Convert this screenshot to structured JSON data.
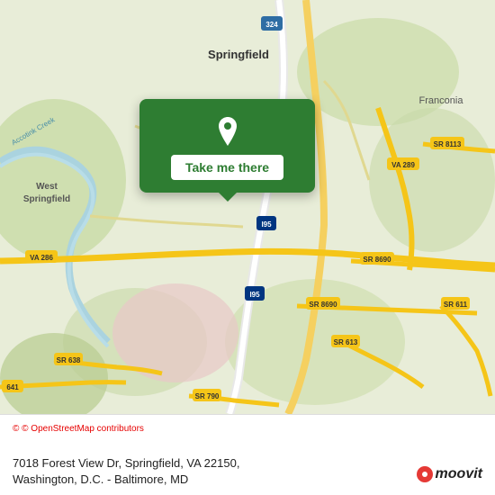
{
  "map": {
    "alt": "Map of Springfield VA area",
    "center_lat": 38.74,
    "center_lng": -77.17
  },
  "popup": {
    "button_label": "Take me there",
    "pin_alt": "location-pin"
  },
  "info_bar": {
    "osm_credit": "© OpenStreetMap contributors",
    "address_line1": "7018 Forest View Dr, Springfield, VA 22150,",
    "address_line2": "Washington, D.C. - Baltimore, MD"
  },
  "branding": {
    "logo_name": "moovit",
    "logo_text": "moovit"
  },
  "roads": {
    "accent_color": "#f5c518",
    "highway_color": "#ffffff",
    "minor_road_color": "#ffffaa",
    "water_color": "#aad3df",
    "green_area": "#c8e6c9",
    "pink_area": "#f8bbd0"
  }
}
